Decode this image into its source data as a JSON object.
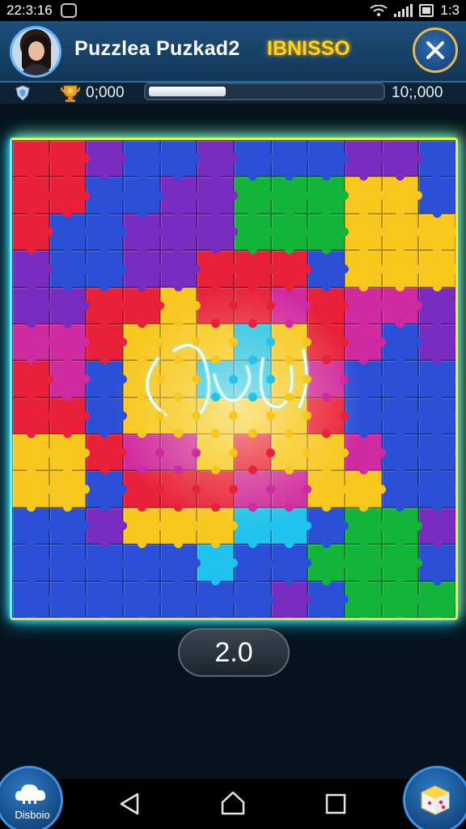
{
  "status_bar": {
    "time": "22:3:16",
    "right_time": "1:3",
    "icons": [
      "notification-icon",
      "wifi-icon",
      "signal-icon",
      "battery-icon"
    ]
  },
  "header": {
    "title": "Puzzlea Puzkad2",
    "badge": "IBNISSO",
    "close_icon": "close-icon"
  },
  "progress": {
    "left_value": "0;000",
    "right_value": "10;,000",
    "fill_fraction": 0.35
  },
  "timer": {
    "value": "2.0"
  },
  "left_button": {
    "label": "Disboio",
    "icon": "cloud-icon"
  },
  "right_button": {
    "icon": "cube-icon"
  },
  "nav": {
    "back_icon": "back-icon",
    "home_icon": "home-icon",
    "recent_icon": "recent-apps-icon"
  },
  "colors": {
    "red": "#e8203a",
    "blue": "#2c4fd8",
    "purple": "#7a2bc0",
    "green": "#12b53a",
    "yellow": "#f7c71d",
    "magenta": "#d02aa0",
    "cyan": "#1fc3ee",
    "orange": "#ff5a1c",
    "board_glow": "#62f0ff"
  },
  "board": {
    "rows": 13,
    "cols": 12,
    "grid": [
      "RRPBBPBBBPPB",
      "RRBBPPGGGYYB",
      "RBBPPPGGGYYY",
      "PBBPPRRRBYYY",
      "PPRRYRRMRMMP",
      "MMRYYYCYRMBP",
      "RMBYYCCYMBBB",
      "RRBYYYYYRBBB",
      "YYRMMYRYYMBB",
      "YYBRRRMMYYBB",
      "BBPYYYCCBGGP",
      "BBBBBCBBGGGB",
      "BBBBBBBPBGGG"
    ]
  }
}
